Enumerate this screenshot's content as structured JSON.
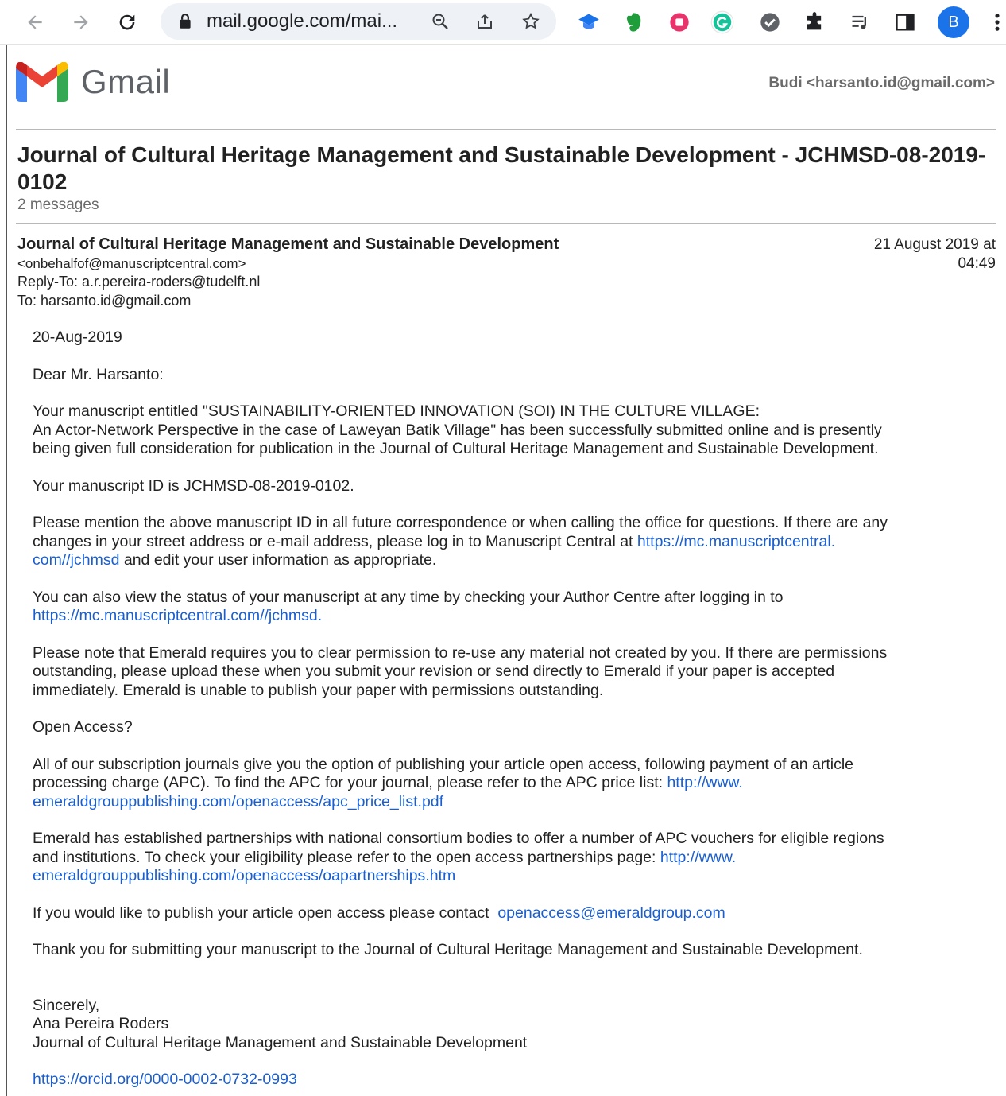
{
  "browser": {
    "url": "mail.google.com/mai...",
    "profile_initial": "B"
  },
  "gmail": {
    "logo_text": "Gmail",
    "account": "Budi <harsanto.id@gmail.com>"
  },
  "thread": {
    "subject": "Journal of Cultural Heritage Management and Sustainable Development - JCHMSD-08-2019-0102",
    "message_count": "2 messages"
  },
  "message": {
    "from_name": "Journal of Cultural Heritage Management and Sustainable Development",
    "from_email": "<onbehalfof@manuscriptcentral.com>",
    "reply_to": "Reply-To: a.r.pereira-roders@tudelft.nl",
    "to": "To: harsanto.id@gmail.com",
    "date_line1": "21 August 2019 at",
    "date_line2": "04:49"
  },
  "body": {
    "date": "20-Aug-2019",
    "greeting": "Dear Mr. Harsanto:",
    "p1_line1": "Your manuscript entitled \"SUSTAINABILITY-ORIENTED INNOVATION (SOI) IN THE CULTURE VILLAGE:",
    "p1_line2": "An Actor-Network Perspective in the case of Laweyan Batik Village\" has been successfully submitted online and is presently",
    "p1_line3": "being given full consideration for publication in the Journal of Cultural Heritage Management and Sustainable Development.",
    "p2": "Your manuscript ID is JCHMSD-08-2019-0102.",
    "p3_line1": "Please mention the above manuscript ID in all future correspondence or when calling the office for questions. If there are any",
    "p3_line2": "changes in your street address or e-mail address, please log in to Manuscript Central at ",
    "p3_link_a": "https://mc.manuscriptcentral.",
    "p3_link_b": "com//jchmsd",
    "p3_tail": " and edit your user information as appropriate.",
    "p4_line1": "You can also view the status of your manuscript at any time by checking your Author Centre after logging in to",
    "p4_link": "https://mc.manuscriptcentral.com//jchmsd.",
    "p5_line1": "Please note that Emerald requires you to clear permission to re-use any material not created by you.  If there are permissions",
    "p5_line2": "outstanding, please upload these when you submit your revision or send directly to Emerald if your paper is accepted",
    "p5_line3": "immediately.  Emerald is unable to publish your paper with permissions outstanding.",
    "p6": "Open Access?",
    "p7_line1": "All of our subscription journals give you the option of publishing your article open access, following payment of an article",
    "p7_line2": "processing charge (APC). To find the APC for your journal, please refer to the  APC price list: ",
    "p7_link_a": "http://www.",
    "p7_link_b": "emeraldgrouppublishing.com/openaccess/apc_price_list.pdf",
    "p8_line1": "Emerald has established partnerships with national consortium bodies to offer a number of APC vouchers for eligible regions",
    "p8_line2": "and institutions. To check your eligibility please refer to the open access partnerships page: ",
    "p8_link_a": "http://www.",
    "p8_link_b": "emeraldgrouppublishing.com/openaccess/oapartnerships.htm",
    "p9_text": "If you would like to publish your article open access please contact  ",
    "p9_link": "openaccess@emeraldgroup.com",
    "p10": "Thank you for submitting your manuscript to the Journal of Cultural Heritage Management and Sustainable Development.",
    "sign1": "Sincerely,",
    "sign2": "Ana Pereira Roders",
    "sign3": "Journal of Cultural Heritage Management and Sustainable Development",
    "orcid": "https://orcid.org/0000-0002-0732-0993"
  }
}
